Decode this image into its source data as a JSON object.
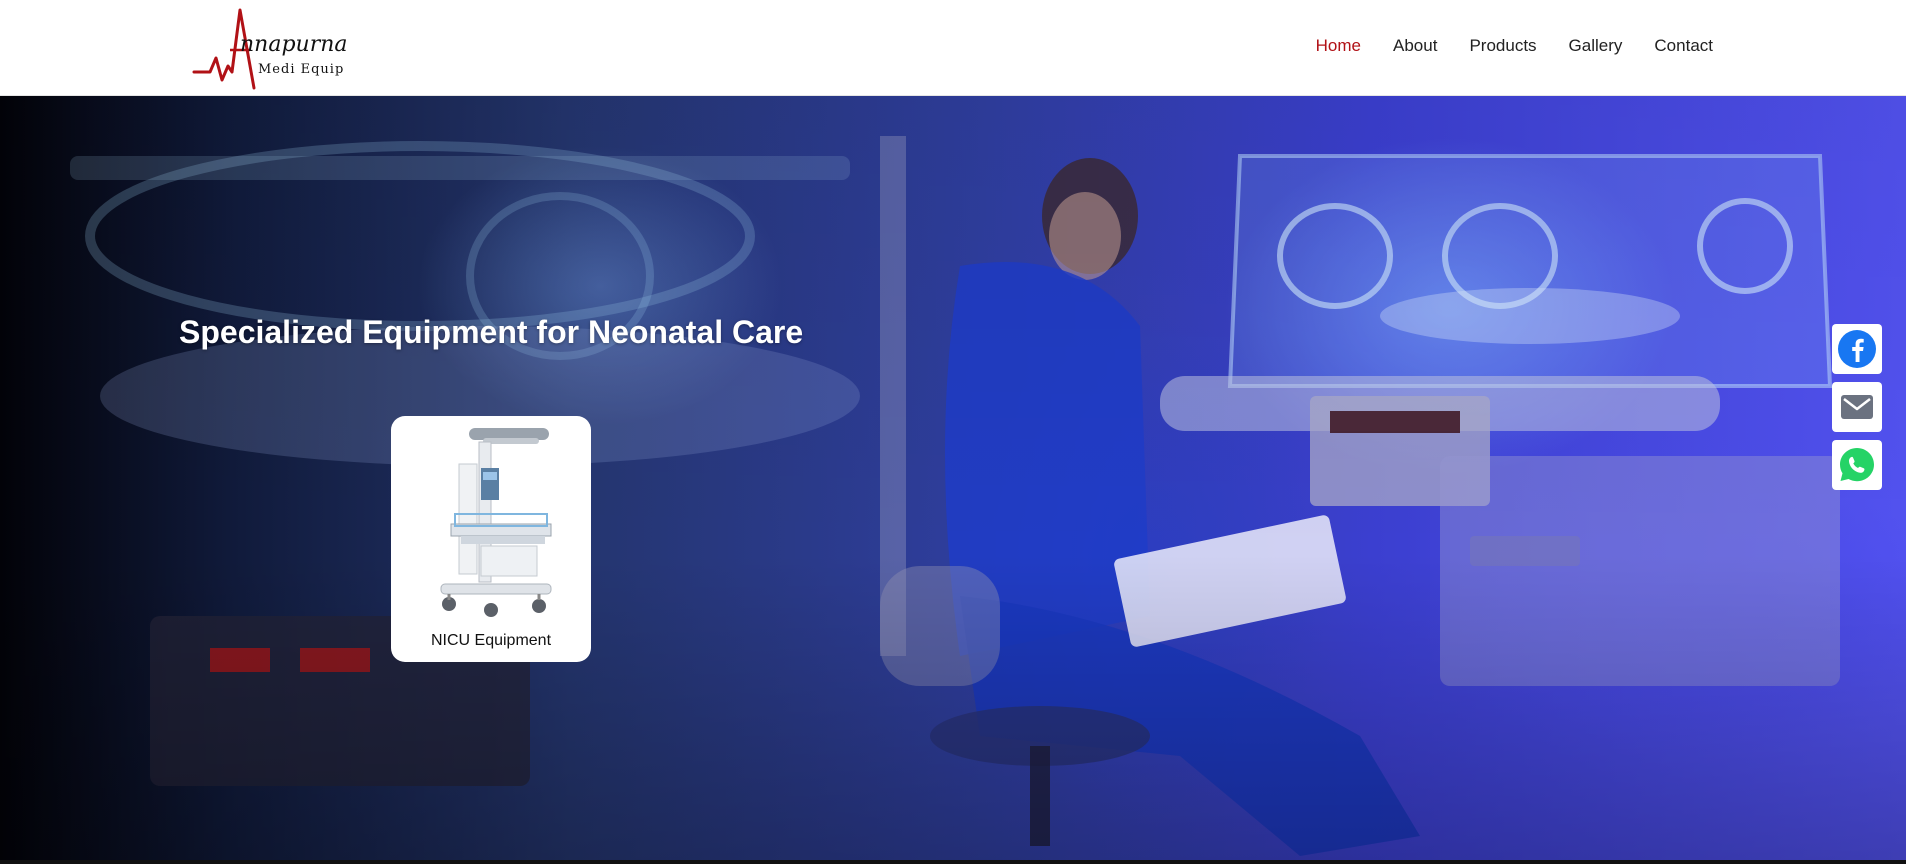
{
  "brand": {
    "name": "nnapurna",
    "tagline": "Medi Equip",
    "accent_color": "#b11116"
  },
  "nav": {
    "items": [
      {
        "label": "Home",
        "active": true
      },
      {
        "label": "About",
        "active": false
      },
      {
        "label": "Products",
        "active": false
      },
      {
        "label": "Gallery",
        "active": false
      },
      {
        "label": "Contact",
        "active": false
      }
    ]
  },
  "hero": {
    "title": "Specialized Equipment for Neonatal Care"
  },
  "products": [
    {
      "label": "NICU Equipment",
      "icon": "radiant-warmer-image"
    }
  ],
  "social": [
    {
      "icon": "facebook-icon",
      "color": "#1877f2"
    },
    {
      "icon": "email-icon",
      "color": "#6b7280"
    },
    {
      "icon": "whatsapp-icon",
      "color": "#25d366"
    }
  ]
}
